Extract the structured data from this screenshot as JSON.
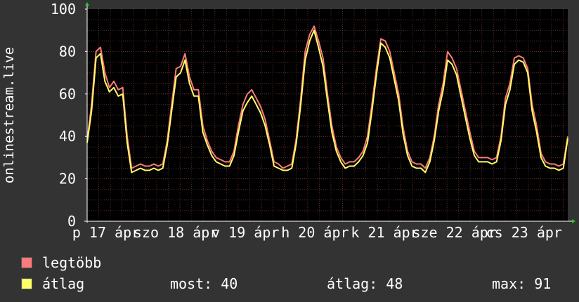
{
  "chart_data": {
    "type": "line",
    "ylabel": "onlinestream.live",
    "ylim": [
      0,
      100
    ],
    "yticks": [
      "0",
      "20",
      "40",
      "60",
      "80",
      "100"
    ],
    "xticks": [
      "p 17 ápr",
      "szo 18 ápr",
      "v 19 ápr",
      "h 20 ápr",
      "k 21 ápr",
      "sze 22 ápr",
      "cs 23 ápr"
    ],
    "grid": true,
    "colors": {
      "background": "#333333",
      "plot": "#000000",
      "grid": "#5a2a2a",
      "axis": "#ffffff"
    },
    "series": [
      {
        "name": "legtöbb",
        "color": "#ff7a7a",
        "values": [
          38,
          55,
          80,
          82,
          70,
          63,
          66,
          62,
          63,
          40,
          25,
          26,
          27,
          26,
          26,
          27,
          26,
          27,
          38,
          55,
          72,
          73,
          79,
          68,
          62,
          62,
          45,
          38,
          33,
          30,
          29,
          28,
          28,
          33,
          45,
          55,
          60,
          62,
          58,
          54,
          48,
          38,
          28,
          27,
          25,
          26,
          27,
          39,
          58,
          80,
          88,
          92,
          85,
          77,
          60,
          45,
          35,
          30,
          27,
          28,
          28,
          30,
          33,
          40,
          55,
          72,
          86,
          85,
          80,
          70,
          60,
          44,
          33,
          28,
          27,
          27,
          25,
          30,
          40,
          55,
          65,
          80,
          77,
          72,
          62,
          52,
          42,
          33,
          30,
          30,
          30,
          29,
          30,
          40,
          58,
          65,
          77,
          78,
          77,
          72,
          55,
          45,
          32,
          28,
          27,
          27,
          26,
          27,
          40
        ]
      },
      {
        "name": "átlag",
        "color": "#ffff66",
        "values": [
          37,
          52,
          77,
          79,
          66,
          61,
          63,
          59,
          60,
          37,
          23,
          24,
          25,
          24,
          24,
          25,
          24,
          25,
          36,
          52,
          68,
          70,
          76,
          65,
          59,
          59,
          42,
          36,
          31,
          28,
          27,
          26,
          26,
          31,
          42,
          52,
          56,
          59,
          55,
          51,
          45,
          36,
          26,
          25,
          24,
          24,
          25,
          37,
          55,
          76,
          85,
          90,
          82,
          73,
          57,
          42,
          33,
          28,
          25,
          26,
          26,
          28,
          31,
          37,
          52,
          69,
          84,
          82,
          77,
          67,
          57,
          41,
          31,
          26,
          25,
          25,
          23,
          28,
          38,
          52,
          62,
          76,
          74,
          69,
          59,
          49,
          39,
          31,
          28,
          28,
          28,
          27,
          28,
          38,
          55,
          62,
          74,
          76,
          75,
          70,
          52,
          42,
          30,
          26,
          25,
          25,
          24,
          25,
          39
        ]
      }
    ]
  },
  "legend": [
    {
      "label": "legtöbb",
      "color": "#ff7a7a"
    },
    {
      "label": "átlag",
      "color": "#ffff66"
    }
  ],
  "stats": {
    "now": "most: 40",
    "avg": "átlag: 48",
    "max": "max: 91"
  }
}
